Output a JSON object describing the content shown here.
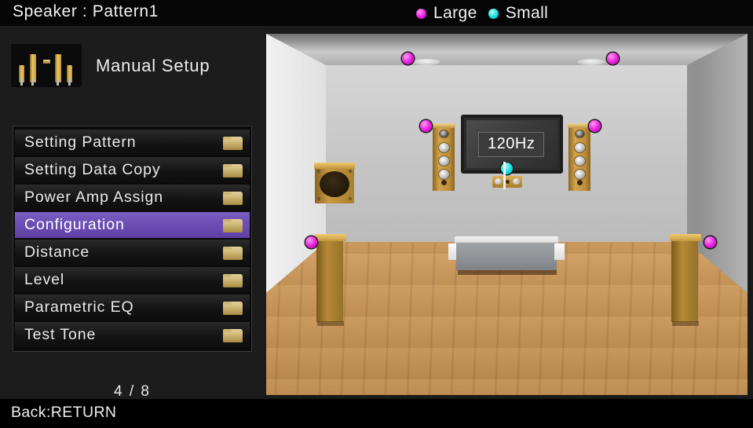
{
  "header": {
    "speaker_label": "Speaker : Pattern1",
    "legend": [
      {
        "label": "Large",
        "color": "#e81ce0",
        "icon": "legend-dot-magenta"
      },
      {
        "label": "Small",
        "color": "#12dede",
        "icon": "legend-dot-cyan"
      }
    ]
  },
  "sidebar": {
    "icon_name": "manual-setup-speakers-icon",
    "title": "Manual Setup",
    "items": [
      {
        "label": "Setting Pattern",
        "selected": false,
        "icon": "folder-icon"
      },
      {
        "label": "Setting Data Copy",
        "selected": false,
        "icon": "folder-icon"
      },
      {
        "label": "Power Amp Assign",
        "selected": false,
        "icon": "folder-icon"
      },
      {
        "label": "Configuration",
        "selected": true,
        "icon": "folder-icon"
      },
      {
        "label": "Distance",
        "selected": false,
        "icon": "folder-icon"
      },
      {
        "label": "Level",
        "selected": false,
        "icon": "folder-icon"
      },
      {
        "label": "Parametric EQ",
        "selected": false,
        "icon": "folder-icon"
      },
      {
        "label": "Test Tone",
        "selected": false,
        "icon": "folder-icon"
      }
    ],
    "page_indicator": "4 / 8",
    "selection_color": "#6c4eb4"
  },
  "room": {
    "crossover_badge": "120Hz",
    "speakers": [
      {
        "name": "ceiling-speaker-left",
        "size": "Large",
        "marker": "large"
      },
      {
        "name": "ceiling-speaker-right",
        "size": "Large",
        "marker": "large"
      },
      {
        "name": "front-left-speaker",
        "size": "Large",
        "marker": "large"
      },
      {
        "name": "front-right-speaker",
        "size": "Large",
        "marker": "large"
      },
      {
        "name": "center-speaker",
        "size": "Small",
        "marker": "small"
      },
      {
        "name": "surround-left-speaker",
        "size": "Large",
        "marker": "large"
      },
      {
        "name": "surround-right-speaker",
        "size": "Large",
        "marker": "large"
      },
      {
        "name": "subwoofer",
        "size": "",
        "marker": ""
      }
    ]
  },
  "footer": {
    "back_hint": "Back:RETURN"
  }
}
